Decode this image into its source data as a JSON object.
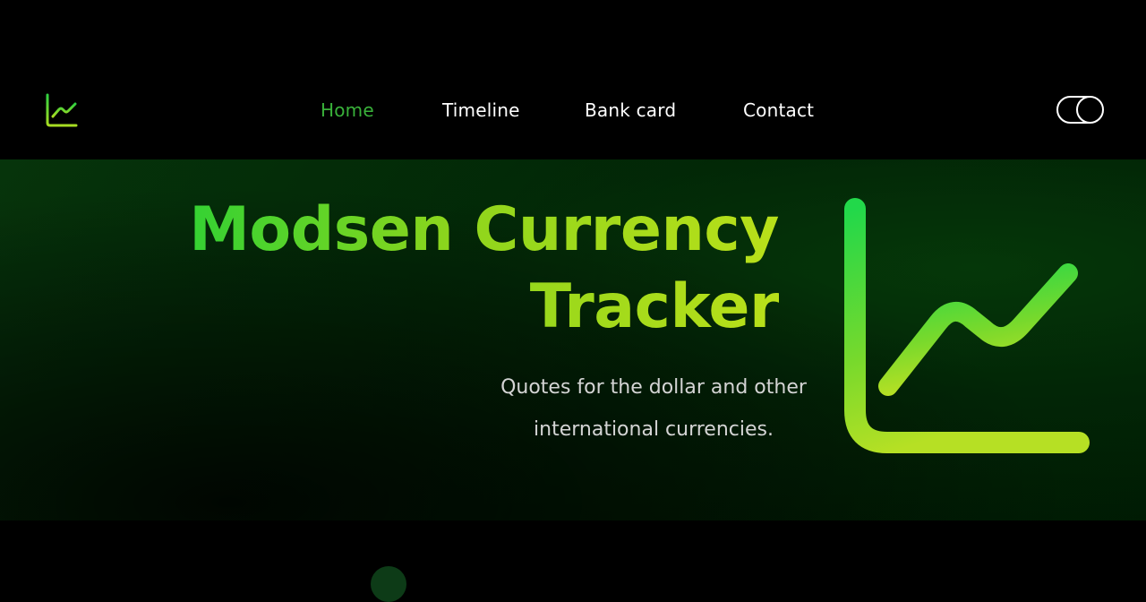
{
  "header": {
    "logo_icon": "chart-line-icon",
    "nav": [
      {
        "label": "Home",
        "active": true
      },
      {
        "label": "Timeline",
        "active": false
      },
      {
        "label": "Bank card",
        "active": false
      },
      {
        "label": "Contact",
        "active": false
      }
    ],
    "theme_toggle_icon": "toggle-icon"
  },
  "hero": {
    "title_line1": "Modsen Currency",
    "title_line2": "Tracker",
    "subtitle_line1": "Quotes for the dollar and other",
    "subtitle_line2": "international currencies.",
    "graphic_icon": "chart-line-icon"
  },
  "colors": {
    "accent": "#39b13a",
    "gradient_start": "#34d233",
    "gradient_end": "#b9e01a",
    "background": "#000000"
  }
}
